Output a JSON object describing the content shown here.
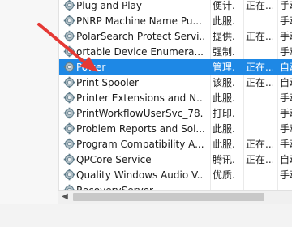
{
  "services": [
    {
      "name": "Plug and Play",
      "desc": "便计...",
      "status": "正在...",
      "start": "手动",
      "selected": false
    },
    {
      "name": "PNRP Machine Name Pu...",
      "desc": "此服...",
      "status": "",
      "start": "手动",
      "selected": false
    },
    {
      "name": "PolarSearch Protect Servi...",
      "desc": "提供...",
      "status": "正在...",
      "start": "手动",
      "selected": false
    },
    {
      "name": "ortable Device Enumera...",
      "desc": "强制...",
      "status": "",
      "start": "手动",
      "selected": false
    },
    {
      "name": "Power",
      "desc": "管理...",
      "status": "正在...",
      "start": "自动",
      "selected": true
    },
    {
      "name": "Print Spooler",
      "desc": "该服...",
      "status": "正在...",
      "start": "自动",
      "selected": false
    },
    {
      "name": "Printer Extensions and N...",
      "desc": "此服...",
      "status": "",
      "start": "手动",
      "selected": false
    },
    {
      "name": "PrintWorkflowUserSvc_78...",
      "desc": "打印...",
      "status": "",
      "start": "手动",
      "selected": false
    },
    {
      "name": "Problem Reports and Sol...",
      "desc": "此服...",
      "status": "",
      "start": "手动",
      "selected": false
    },
    {
      "name": "Program Compatibility A...",
      "desc": "此服...",
      "status": "正在...",
      "start": "手动",
      "selected": false
    },
    {
      "name": "QPCore Service",
      "desc": "腾讯...",
      "status": "正在...",
      "start": "自动",
      "selected": false
    },
    {
      "name": "Quality Windows Audio V...",
      "desc": "优质...",
      "status": "",
      "start": "手动",
      "selected": false
    },
    {
      "name": "RecoveryServer",
      "desc": "",
      "status": "",
      "start": "",
      "selected": false
    }
  ],
  "icons": {
    "service": "gear-icon",
    "scroll_left": "chevron-left-icon"
  },
  "colors": {
    "selection": "#1e88e5",
    "annotation_arrow": "#e53935"
  }
}
